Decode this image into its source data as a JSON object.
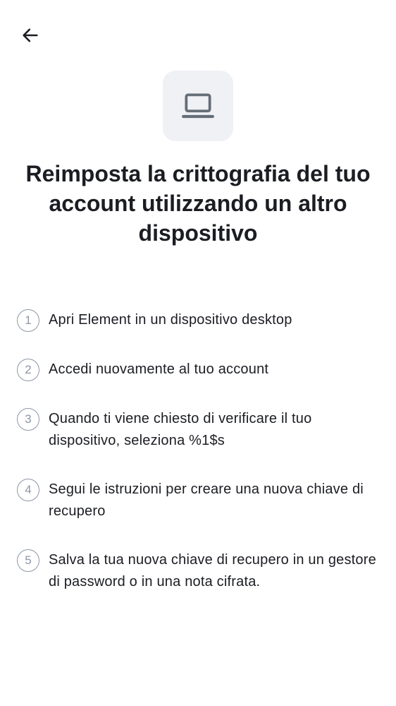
{
  "header": {
    "back_icon": "arrow-left-icon"
  },
  "hero": {
    "icon": "laptop-icon",
    "icon_bg_color": "#eff1f5",
    "icon_color": "#656d77"
  },
  "title": "Reimposta la crittografia del tuo account utilizzando un altro dispositivo",
  "steps": [
    {
      "number": "1",
      "text": "Apri Element in un dispositivo desktop"
    },
    {
      "number": "2",
      "text": "Accedi nuovamente al tuo account"
    },
    {
      "number": "3",
      "text": "Quando ti viene chiesto di verificare il tuo dispositivo, seleziona %1$s"
    },
    {
      "number": "4",
      "text": "Segui le istruzioni per creare una nuova chiave di recupero"
    },
    {
      "number": "5",
      "text": "Salva la tua nuova chiave di recupero in un gestore di password o in una nota cifrata."
    }
  ],
  "colors": {
    "text_primary": "#1b1d22",
    "step_circle": "#8d97a5",
    "background": "#ffffff"
  }
}
